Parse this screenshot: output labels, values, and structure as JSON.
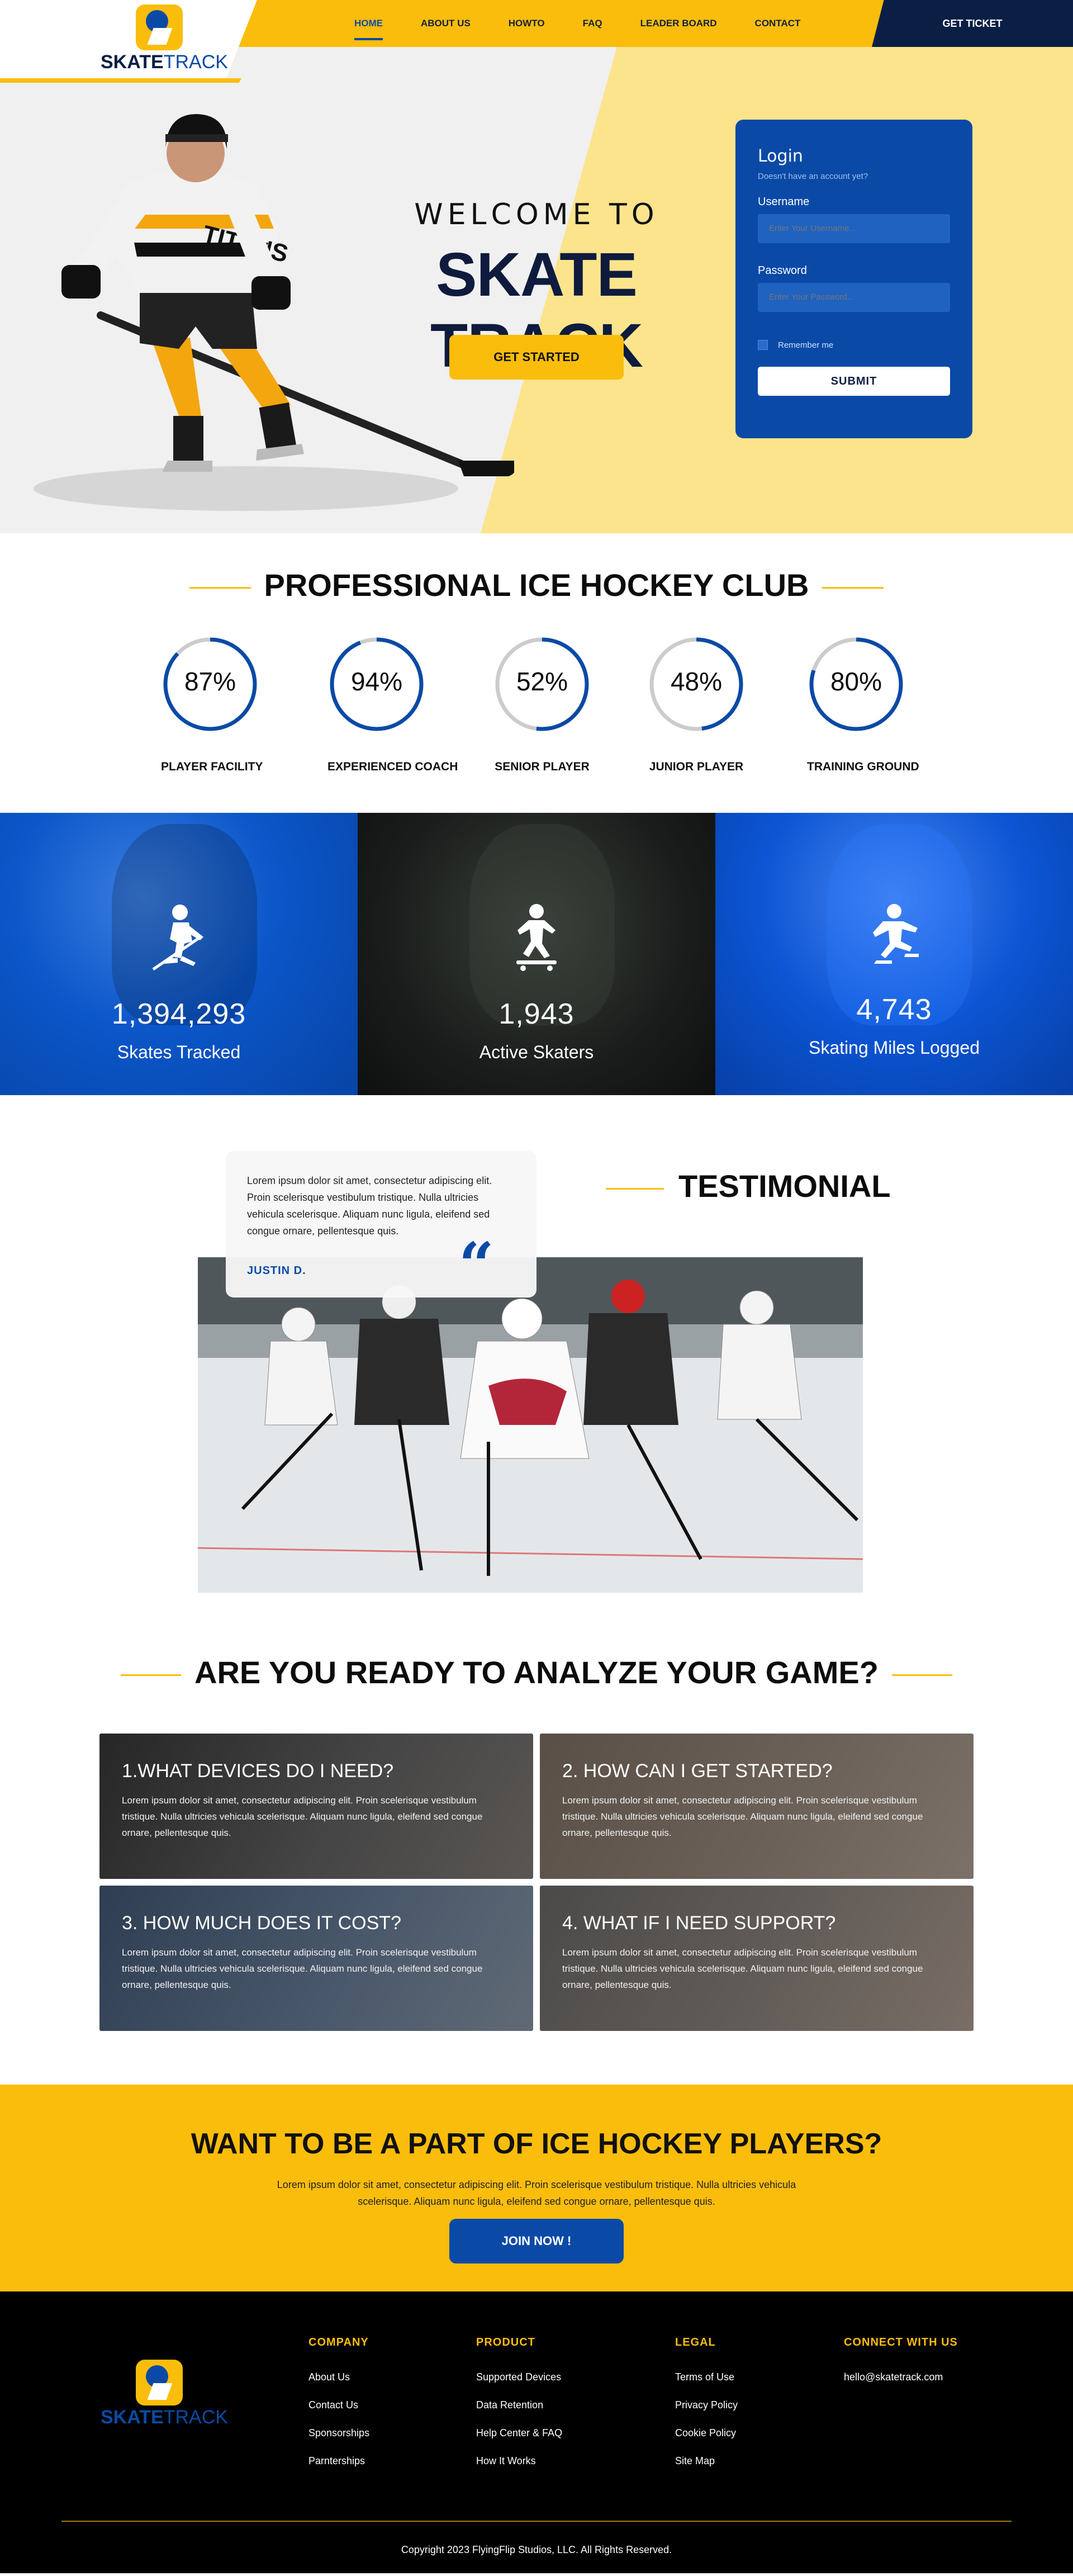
{
  "header": {
    "logo": {
      "part1": "SKATE",
      "part2": "TRACK"
    },
    "nav": [
      "HOME",
      "ABOUT US",
      "HOWTO",
      "FAQ",
      "LEADER BOARD",
      "CONTACT"
    ],
    "ticket_label": "GET TICKET"
  },
  "hero": {
    "welcome": "WELCOME TO",
    "brand": "SKATE TRACK",
    "cta_label": "GET STARTED"
  },
  "login": {
    "title": "Login",
    "subtitle": "Doesn't have an account yet?",
    "username_label": "Username",
    "username_placeholder": "Enter Your Username...",
    "password_label": "Password",
    "password_placeholder": "Enter Your Password...",
    "remember_label": "Remember me",
    "submit_label": "SUBMIT"
  },
  "club": {
    "title": "PROFESSIONAL ICE HOCKEY CLUB",
    "stats": [
      {
        "value": 87,
        "display": "87%",
        "label": "PLAYER FACILITY"
      },
      {
        "value": 94,
        "display": "94%",
        "label": "EXPERIENCED COACH"
      },
      {
        "value": 52,
        "display": "52%",
        "label": "SENIOR PLAYER"
      },
      {
        "value": 48,
        "display": "48%",
        "label": "JUNIOR PLAYER"
      },
      {
        "value": 80,
        "display": "80%",
        "label": "TRAINING GROUND"
      }
    ],
    "ring_color": "#0a4aa6",
    "track_color": "#cccccc"
  },
  "tiles": [
    {
      "number": "1,394,293",
      "label": "Skates Tracked",
      "icon": "hockey-player-icon"
    },
    {
      "number": "1,943",
      "label": "Active Skaters",
      "icon": "skateboarder-icon"
    },
    {
      "number": "4,743",
      "label": "Skating Miles Logged",
      "icon": "ice-skater-icon"
    }
  ],
  "testimonial": {
    "heading": "TESTIMONIAL",
    "text": "Lorem ipsum dolor sit amet, consectetur adipiscing elit. Proin scelerisque vestibulum tristique. Nulla ultricies vehicula scelerisque. Aliquam nunc ligula, eleifend sed congue ornare, pellentesque quis.",
    "author": "JUSTIN D."
  },
  "faq": {
    "title": "ARE YOU READY TO ANALYZE YOUR GAME?",
    "items": [
      {
        "q": "1.WHAT DEVICES DO I NEED?",
        "a": "Lorem ipsum dolor sit amet, consectetur adipiscing elit. Proin scelerisque vestibulum tristique. Nulla ultricies vehicula scelerisque. Aliquam nunc ligula, eleifend sed congue ornare, pellentesque quis."
      },
      {
        "q": "2. HOW CAN I GET STARTED?",
        "a": "Lorem ipsum dolor sit amet, consectetur adipiscing elit. Proin scelerisque vestibulum tristique. Nulla ultricies vehicula scelerisque. Aliquam nunc ligula, eleifend sed congue ornare, pellentesque quis."
      },
      {
        "q": "3. HOW MUCH DOES IT COST?",
        "a": "Lorem ipsum dolor sit amet, consectetur adipiscing elit. Proin scelerisque vestibulum tristique. Nulla ultricies vehicula scelerisque. Aliquam nunc ligula, eleifend sed congue ornare, pellentesque quis."
      },
      {
        "q": "4. WHAT IF I NEED SUPPORT?",
        "a": "Lorem ipsum dolor sit amet, consectetur adipiscing elit. Proin scelerisque vestibulum tristique. Nulla ultricies vehicula scelerisque. Aliquam nunc ligula, eleifend sed congue ornare, pellentesque quis."
      }
    ]
  },
  "cta": {
    "title": "WANT TO BE A PART OF ICE HOCKEY PLAYERS?",
    "text": "Lorem ipsum dolor sit amet, consectetur adipiscing elit. Proin scelerisque vestibulum tristique. Nulla ultricies vehicula scelerisque. Aliquam nunc ligula, eleifend sed congue ornare, pellentesque quis.",
    "button": "JOIN NOW !"
  },
  "footer": {
    "company": {
      "title": "COMPANY",
      "links": [
        "About Us",
        "Contact Us",
        "Sponsorships",
        "Parnterships"
      ]
    },
    "product": {
      "title": "PRODUCT",
      "links": [
        "Supported Devices",
        "Data Retention",
        "Help Center & FAQ",
        "How It Works"
      ]
    },
    "legal": {
      "title": "LEGAL",
      "links": [
        "Terms of Use",
        "Privacy Policy",
        "Cookie Policy",
        "Site Map"
      ]
    },
    "connect": {
      "title": "CONNECT WITH US",
      "email": "hello@skatetrack.com"
    },
    "copyright": "Copyright 2023 FlyingFlip Studios, LLC. All Rights Reserved."
  },
  "colors": {
    "accent_yellow": "#fbbd0b",
    "brand_blue": "#0a4aa6",
    "navy": "#0b1f45"
  }
}
